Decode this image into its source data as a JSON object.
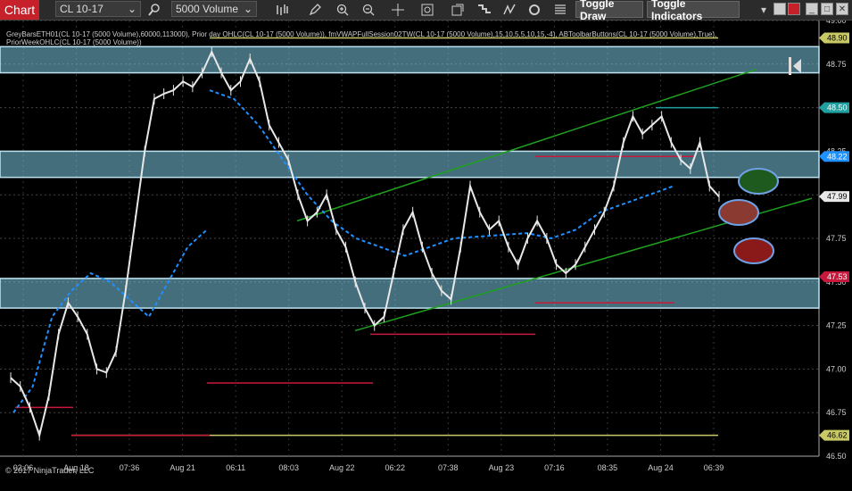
{
  "toolbar": {
    "chart_tab": "Chart",
    "instrument": "CL 10-17",
    "bar_type": "5000 Volume",
    "toggle_draw": "Toggle Draw",
    "toggle_indicators": "Toggle Indicators",
    "icons": [
      "search-icon",
      "bars-icon",
      "pencil-icon",
      "zoom-in-icon",
      "zoom-out-icon",
      "crosshair-icon",
      "properties-icon",
      "strategy-icon",
      "indicator-icon",
      "refresh-icon",
      "menu-icon"
    ]
  },
  "indicator_line1": "GreyBarsETH01(CL 10-17 (5000 Volume),60000,113000), Prior day OHLC(CL 10-17 (5000 Volume)), fmVWAPFullSession02TW(CL 10-17 (5000 Volume),15,10,5,5,10,15,-4), ABToolbarButtons(CL 10-17 (5000 Volume),True),",
  "indicator_line2": "PriorWeekOHLC(CL 10-17 (5000 Volume))",
  "copyright": "© 2017 NinjaTrader, LLC",
  "colors": {
    "background": "#000000",
    "price": "#e8e8e8",
    "vwap": "#1e90ff",
    "trend": "#1ea01e",
    "zone": "#7ec8e3",
    "support": "#c8193c",
    "high_level": "#c8c864"
  },
  "chart_data": {
    "type": "line",
    "title": "",
    "ylim": [
      46.5,
      49.0
    ],
    "y_ticks": [
      "49.00",
      "48.75",
      "48.50",
      "48.25",
      "48.00",
      "47.75",
      "47.50",
      "47.25",
      "47.00",
      "46.75",
      "46.50"
    ],
    "x_ticks": [
      "02:06",
      "Aug 18",
      "07:36",
      "Aug 21",
      "06:11",
      "08:03",
      "Aug 22",
      "06:22",
      "07:38",
      "Aug 23",
      "07:16",
      "08:35",
      "Aug 24",
      "06:39"
    ],
    "price_labels": [
      {
        "text": "48.90",
        "value": 48.9,
        "color": "#c8c864"
      },
      {
        "text": "48.50",
        "value": 48.5,
        "color": "#20a0a0"
      },
      {
        "text": "48.22",
        "value": 48.22,
        "color": "#1e90ff"
      },
      {
        "text": "47.99",
        "value": 47.99,
        "color": "#e8e8e8"
      },
      {
        "text": "47.53",
        "value": 47.53,
        "color": "#c8193c"
      },
      {
        "text": "46.62",
        "value": 46.62,
        "color": "#c8c864"
      }
    ],
    "series": [
      {
        "values": [
          46.95,
          46.9,
          46.78,
          46.62,
          46.85,
          47.2,
          47.38,
          47.3,
          47.2,
          47.0,
          46.98,
          47.1,
          47.45,
          47.85,
          48.25,
          48.55,
          48.58,
          48.6,
          48.65,
          48.62,
          48.7,
          48.82,
          48.7,
          48.6,
          48.65,
          48.78,
          48.65,
          48.4,
          48.3,
          48.2,
          48.0,
          47.85,
          47.9,
          48.0,
          47.8,
          47.7,
          47.5,
          47.35,
          47.25,
          47.3,
          47.55,
          47.8,
          47.9,
          47.7,
          47.55,
          47.45,
          47.4,
          47.7,
          48.05,
          47.9,
          47.8,
          47.85,
          47.7,
          47.6,
          47.75,
          47.85,
          47.75,
          47.6,
          47.55,
          47.6,
          47.7,
          47.8,
          47.9,
          48.05,
          48.3,
          48.45,
          48.35,
          48.4,
          48.45,
          48.3,
          48.2,
          48.15,
          48.3,
          48.05,
          47.99
        ]
      },
      {
        "values": [
          46.75,
          46.9,
          47.3,
          47.45,
          47.55,
          47.5,
          47.4,
          47.3,
          47.5,
          47.7,
          47.8
        ]
      },
      {
        "values": [
          48.6,
          48.55,
          48.4,
          48.2,
          48.0,
          47.85,
          47.75,
          47.7,
          47.65,
          47.7,
          47.75,
          47.76,
          47.77,
          47.78,
          47.75,
          47.8,
          47.9,
          47.95,
          48.0,
          48.05
        ]
      }
    ],
    "zones": [
      [
        48.7,
        48.85
      ],
      [
        48.1,
        48.25
      ],
      [
        47.35,
        47.52
      ]
    ],
    "levels": [
      48.9,
      48.5,
      47.53,
      47.2,
      46.62
    ],
    "trendlines": [
      [
        47.85,
        48.72
      ],
      [
        47.22,
        47.98
      ]
    ],
    "ellipses": [
      "green",
      "brown",
      "red"
    ]
  }
}
